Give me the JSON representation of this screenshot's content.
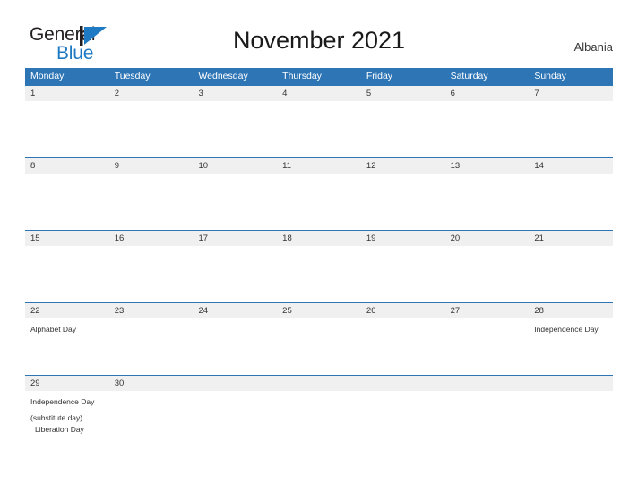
{
  "brand": {
    "name_part1": "General",
    "name_part2": "Blue",
    "mark_icon": "triangle-flag-icon",
    "accent_color": "#1f7ac4"
  },
  "header": {
    "title": "November 2021",
    "country": "Albania"
  },
  "theme": {
    "header_blue": "#2e75b6",
    "date_band_gray": "#f0f0f0",
    "text_color": "#333333"
  },
  "calendar": {
    "month": "November",
    "year": "2021",
    "week_start": "Monday",
    "day_headers": [
      "Monday",
      "Tuesday",
      "Wednesday",
      "Thursday",
      "Friday",
      "Saturday",
      "Sunday"
    ],
    "weeks": [
      {
        "dates": [
          "1",
          "2",
          "3",
          "4",
          "5",
          "6",
          "7"
        ],
        "events": [
          "",
          "",
          "",
          "",
          "",
          "",
          ""
        ]
      },
      {
        "dates": [
          "8",
          "9",
          "10",
          "11",
          "12",
          "13",
          "14"
        ],
        "events": [
          "",
          "",
          "",
          "",
          "",
          "",
          ""
        ]
      },
      {
        "dates": [
          "15",
          "16",
          "17",
          "18",
          "19",
          "20",
          "21"
        ],
        "events": [
          "",
          "",
          "",
          "",
          "",
          "",
          ""
        ]
      },
      {
        "dates": [
          "22",
          "23",
          "24",
          "25",
          "26",
          "27",
          "28"
        ],
        "events": [
          "Alphabet Day",
          "",
          "",
          "",
          "",
          "",
          "Independence Day"
        ]
      },
      {
        "dates": [
          "29",
          "30",
          "",
          "",
          "",
          "",
          ""
        ],
        "events": [
          "Independence Day (substitute day)",
          "",
          "",
          "",
          "",
          "",
          ""
        ],
        "events_extra": [
          "Liberation Day",
          "",
          "",
          "",
          "",
          "",
          ""
        ]
      }
    ]
  }
}
